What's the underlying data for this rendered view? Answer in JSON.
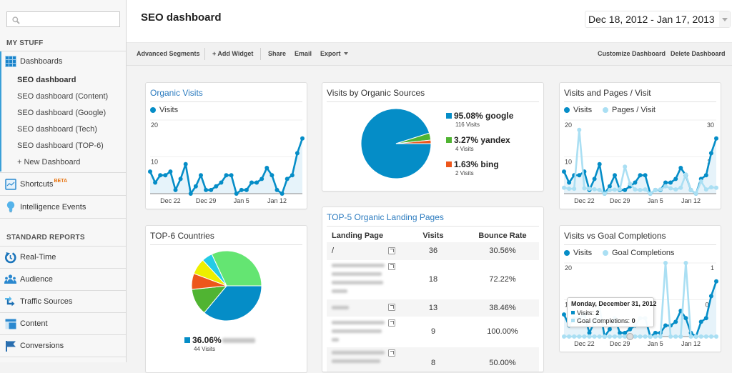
{
  "sidebar": {
    "search": {
      "placeholder": "",
      "value": ""
    },
    "my_stuff": "MY STUFF",
    "dashboards": {
      "label": "Dashboards",
      "items": [
        {
          "label": "SEO dashboard",
          "active": true
        },
        {
          "label": "SEO dashboard (Content)"
        },
        {
          "label": "SEO dashboard (Google)"
        },
        {
          "label": "SEO dashboard (Tech)"
        },
        {
          "label": "SEO dashboard (TOP-6)"
        }
      ],
      "new_label": "+ New Dashboard"
    },
    "shortcuts": {
      "label": "Shortcuts",
      "badge": "BETA"
    },
    "intelligence_events": {
      "label": "Intelligence Events"
    },
    "standard_reports": "STANDARD REPORTS",
    "reports": [
      {
        "label": "Real-Time",
        "icon": "realtime-icon"
      },
      {
        "label": "Audience",
        "icon": "audience-icon"
      },
      {
        "label": "Traffic Sources",
        "icon": "traffic-sources-icon"
      },
      {
        "label": "Content",
        "icon": "content-icon"
      },
      {
        "label": "Conversions",
        "icon": "flag-icon"
      }
    ]
  },
  "header": {
    "title": "SEO dashboard",
    "date_range": "Dec 18, 2012 - Jan 17, 2013"
  },
  "toolbar": {
    "advanced_segments": "Advanced Segments",
    "add_widget": "+ Add Widget",
    "share": "Share",
    "email": "Email",
    "export": "Export",
    "customize": "Customize Dashboard",
    "delete": "Delete Dashboard"
  },
  "colors": {
    "accent": "#058dc7",
    "secondary_series": "#aadff3",
    "area_fill": "#e6f3fa",
    "link_title": "#2b7bbf",
    "beta_badge": "#e8710a",
    "palette": [
      "#058dc7",
      "#50b432",
      "#ed561b",
      "#edef00",
      "#24cbe5",
      "#64e572"
    ]
  },
  "widgets": {
    "landing_pages": {
      "title": "TOP-5 Organic Landing Pages",
      "columns": [
        "Landing Page",
        "Visits",
        "Bounce Rate"
      ],
      "rows": [
        {
          "page": "/",
          "visits": "36",
          "bounce_rate": "30.56%"
        },
        {
          "page": "[redacted]",
          "visits": "18",
          "bounce_rate": "72.22%"
        },
        {
          "page": "[redacted]",
          "visits": "13",
          "bounce_rate": "38.46%"
        },
        {
          "page": "[redacted]",
          "visits": "9",
          "bounce_rate": "100.00%"
        },
        {
          "page": "[redacted]",
          "visits": "8",
          "bounce_rate": "50.00%"
        }
      ]
    },
    "goal_tooltip": {
      "date": "Monday, December 31, 2012",
      "visits_label": "Visits:",
      "visits_value": "2",
      "goals_label": "Goal Completions:",
      "goals_value": "0"
    }
  },
  "chart_data": [
    {
      "type": "line",
      "title": "Organic Visits",
      "x": [
        "Dec 18",
        "Dec 19",
        "Dec 20",
        "Dec 21",
        "Dec 22",
        "Dec 23",
        "Dec 24",
        "Dec 25",
        "Dec 26",
        "Dec 27",
        "Dec 28",
        "Dec 29",
        "Dec 30",
        "Dec 31",
        "Jan 1",
        "Jan 2",
        "Jan 3",
        "Jan 4",
        "Jan 5",
        "Jan 6",
        "Jan 7",
        "Jan 8",
        "Jan 9",
        "Jan 10",
        "Jan 11",
        "Jan 12",
        "Jan 13",
        "Jan 14",
        "Jan 15",
        "Jan 16",
        "Jan 17"
      ],
      "x_ticks": [
        "Dec 22",
        "Dec 29",
        "Jan 5",
        "Jan 12"
      ],
      "series": [
        {
          "name": "Visits",
          "axis": "y_left",
          "color": "#058dc7",
          "values": [
            6,
            3,
            5,
            5,
            6,
            1,
            4,
            8,
            0,
            2,
            5,
            1,
            1,
            2,
            3,
            5,
            5,
            0,
            1,
            1,
            3,
            3,
            4,
            7,
            5,
            1,
            0,
            4,
            5,
            11,
            15
          ]
        }
      ],
      "y_left": {
        "range": [
          0,
          20
        ],
        "ticks": [
          10,
          20
        ]
      },
      "grid": true,
      "legend": "top-left"
    },
    {
      "type": "pie",
      "title": "Visits by Organic Sources",
      "slices": [
        {
          "label": "google",
          "percent": 95.08,
          "visits": 116,
          "percent_text": "95.08% google",
          "visits_text": "116 Visits",
          "color": "#058dc7"
        },
        {
          "label": "yandex",
          "percent": 3.27,
          "visits": 4,
          "percent_text": "3.27% yandex",
          "visits_text": "4 Visits",
          "color": "#50b432"
        },
        {
          "label": "bing",
          "percent": 1.63,
          "visits": 2,
          "percent_text": "1.63% bing",
          "visits_text": "2 Visits",
          "color": "#ed561b"
        }
      ],
      "legend": "right"
    },
    {
      "type": "line",
      "title": "Visits and Pages / Visit",
      "x": [
        "Dec 18",
        "Dec 19",
        "Dec 20",
        "Dec 21",
        "Dec 22",
        "Dec 23",
        "Dec 24",
        "Dec 25",
        "Dec 26",
        "Dec 27",
        "Dec 28",
        "Dec 29",
        "Dec 30",
        "Dec 31",
        "Jan 1",
        "Jan 2",
        "Jan 3",
        "Jan 4",
        "Jan 5",
        "Jan 6",
        "Jan 7",
        "Jan 8",
        "Jan 9",
        "Jan 10",
        "Jan 11",
        "Jan 12",
        "Jan 13",
        "Jan 14",
        "Jan 15",
        "Jan 16",
        "Jan 17"
      ],
      "x_ticks": [
        "Dec 22",
        "Dec 29",
        "Jan 5",
        "Jan 12"
      ],
      "series": [
        {
          "name": "Visits",
          "axis": "y_left",
          "color": "#058dc7",
          "values": [
            6,
            3,
            5,
            5,
            6,
            1,
            4,
            8,
            0,
            2,
            5,
            1,
            1,
            2,
            3,
            5,
            5,
            0,
            1,
            1,
            3,
            3,
            4,
            7,
            5,
            1,
            0,
            4,
            5,
            11,
            15
          ]
        },
        {
          "name": "Pages / Visit",
          "axis": "y_right",
          "color": "#aadff3",
          "values": [
            2.4,
            2.0,
            2.0,
            26.0,
            2.2,
            2.0,
            1.8,
            1.5,
            0,
            1.5,
            1.6,
            1.8,
            11.0,
            4.0,
            1.7,
            1.5,
            1.7,
            0,
            1.5,
            1.7,
            3.0,
            2.2,
            1.7,
            2.4,
            7.8,
            1.5,
            0,
            5.0,
            1.7,
            2.6,
            2.4
          ]
        }
      ],
      "y_left": {
        "range": [
          0,
          20
        ],
        "ticks": [
          10,
          20
        ]
      },
      "y_right": {
        "range": [
          0,
          30
        ],
        "ticks": [
          15,
          30
        ]
      },
      "grid": true,
      "legend": "top-left"
    },
    {
      "type": "pie",
      "title": "TOP-6 Countries",
      "slices": [
        {
          "label": "[redacted]",
          "percent": 36.06,
          "visits": 44,
          "percent_text": "36.06%",
          "visits_text": "44 Visits",
          "color": "#058dc7"
        },
        {
          "percent": 12.3,
          "color": "#50b432"
        },
        {
          "percent": 7.38,
          "color": "#ed561b"
        },
        {
          "percent": 7.38,
          "color": "#edef00"
        },
        {
          "percent": 4.92,
          "color": "#24cbe5"
        },
        {
          "percent": 31.97,
          "color": "#64e572"
        }
      ],
      "legend": "bottom"
    },
    {
      "type": "line",
      "title": "Visits vs Goal Completions",
      "x": [
        "Dec 18",
        "Dec 19",
        "Dec 20",
        "Dec 21",
        "Dec 22",
        "Dec 23",
        "Dec 24",
        "Dec 25",
        "Dec 26",
        "Dec 27",
        "Dec 28",
        "Dec 29",
        "Dec 30",
        "Dec 31",
        "Jan 1",
        "Jan 2",
        "Jan 3",
        "Jan 4",
        "Jan 5",
        "Jan 6",
        "Jan 7",
        "Jan 8",
        "Jan 9",
        "Jan 10",
        "Jan 11",
        "Jan 12",
        "Jan 13",
        "Jan 14",
        "Jan 15",
        "Jan 16",
        "Jan 17"
      ],
      "x_ticks": [
        "Dec 22",
        "Dec 29",
        "Jan 5",
        "Jan 12"
      ],
      "series": [
        {
          "name": "Visits",
          "axis": "y_left",
          "color": "#058dc7",
          "values": [
            6,
            3,
            5,
            5,
            6,
            1,
            4,
            8,
            0,
            2,
            5,
            1,
            1,
            2,
            3,
            5,
            5,
            0,
            1,
            1,
            3,
            3,
            4,
            7,
            5,
            1,
            0,
            4,
            5,
            11,
            15
          ]
        },
        {
          "name": "Goal Completions",
          "axis": "y_right",
          "color": "#aadff3",
          "values": [
            0,
            0,
            0,
            0,
            0,
            0,
            0,
            0,
            0,
            0,
            0,
            0,
            0,
            0,
            0,
            0,
            0,
            0,
            0,
            0,
            1,
            0,
            0,
            0,
            1,
            0,
            0,
            0,
            0,
            0,
            0
          ]
        }
      ],
      "y_left": {
        "range": [
          0,
          20
        ],
        "ticks": [
          10,
          20
        ]
      },
      "y_right": {
        "range": [
          0,
          1
        ],
        "ticks": [
          0.5,
          1
        ]
      },
      "hovered_x": "Dec 31",
      "grid": true,
      "legend": "top-left"
    }
  ]
}
